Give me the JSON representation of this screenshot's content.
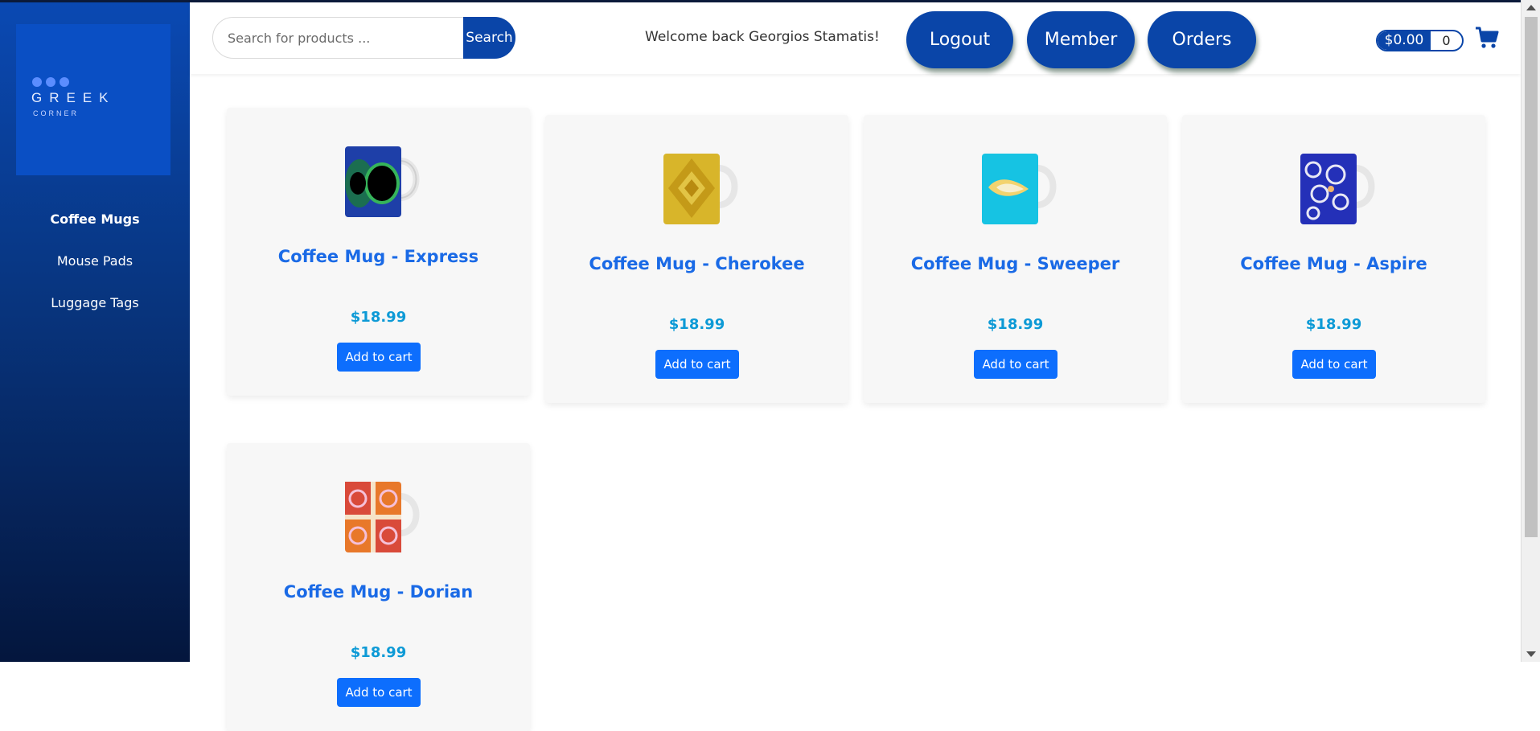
{
  "logo": {
    "word": "GREEK",
    "sub": "CORNER"
  },
  "sidebar": {
    "items": [
      {
        "label": "Coffee Mugs",
        "active": true
      },
      {
        "label": "Mouse Pads",
        "active": false
      },
      {
        "label": "Luggage Tags",
        "active": false
      }
    ]
  },
  "header": {
    "search_placeholder": "Search for products ...",
    "search_label": "Search",
    "welcome": "Welcome back Georgios Stamatis!",
    "logout_label": "Logout",
    "member_label": "Member",
    "orders_label": "Orders",
    "cart_total": "$0.00",
    "cart_count": "0"
  },
  "products": [
    {
      "title": "Coffee Mug - Express",
      "price": "$18.99",
      "button": "Add to cart",
      "pattern": "express"
    },
    {
      "title": "Coffee Mug - Cherokee",
      "price": "$18.99",
      "button": "Add to cart",
      "pattern": "cherokee"
    },
    {
      "title": "Coffee Mug - Sweeper",
      "price": "$18.99",
      "button": "Add to cart",
      "pattern": "sweeper"
    },
    {
      "title": "Coffee Mug - Aspire",
      "price": "$18.99",
      "button": "Add to cart",
      "pattern": "aspire"
    },
    {
      "title": "Coffee Mug - Dorian",
      "price": "$18.99",
      "button": "Add to cart",
      "pattern": "dorian"
    }
  ],
  "colors": {
    "brand": "#0a45a8",
    "title": "#1a6ae6",
    "price": "#0d9ad6",
    "button": "#0d6efd"
  }
}
